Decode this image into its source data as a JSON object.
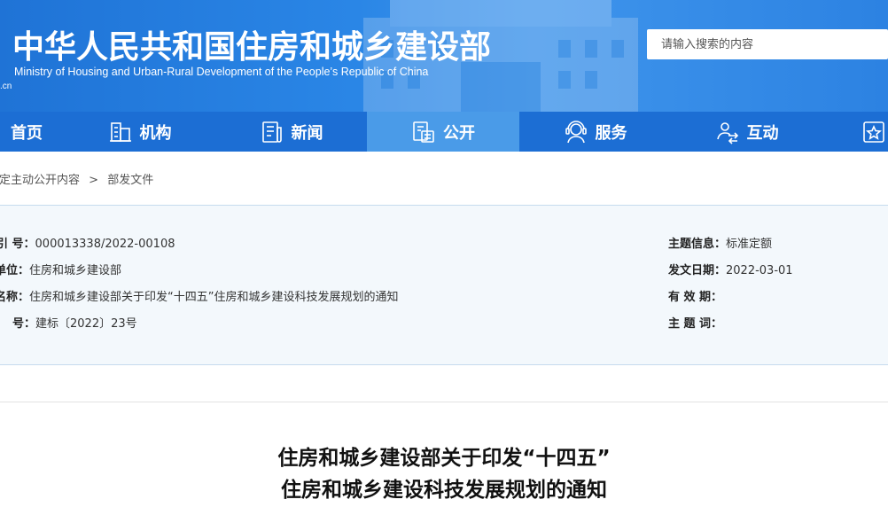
{
  "header": {
    "title": "中华人民共和国住房和城乡建设部",
    "subtitle": "Ministry of Housing and Urban-Rural Development of the People’s Republic of China",
    "domain_fragment": ".cn",
    "search_placeholder": "请输入搜索的内容"
  },
  "nav": {
    "items": [
      {
        "label": "首页",
        "icon": "home-icon"
      },
      {
        "label": "机构",
        "icon": "organization-icon"
      },
      {
        "label": "新闻",
        "icon": "news-icon"
      },
      {
        "label": "公开",
        "icon": "public-info-icon"
      },
      {
        "label": "服务",
        "icon": "service-icon"
      },
      {
        "label": "互动",
        "icon": "interaction-icon"
      },
      {
        "label": "",
        "icon": "star-icon"
      }
    ],
    "active_index": 3
  },
  "breadcrumb": {
    "items": [
      "法定主动公开内容",
      "部发文件"
    ],
    "separator": ">"
  },
  "info": {
    "left": [
      {
        "label": "引  号：",
        "value": "000013338/2022-00108"
      },
      {
        "label": "单位：",
        "value": "住房和城乡建设部"
      },
      {
        "label": "名称：",
        "value": "住房和城乡建设部关于印发“十四五”住房和城乡建设科技发展规划的通知"
      },
      {
        "label": "号：",
        "value": "建标〔2022〕23号"
      }
    ],
    "right": [
      {
        "label": "主题信息：",
        "value": "标准定额"
      },
      {
        "label": "发文日期：",
        "value": "2022-03-01"
      },
      {
        "label": "有 效 期：",
        "value": ""
      },
      {
        "label": "主 题 词：",
        "value": ""
      }
    ]
  },
  "document": {
    "title_line1": "住房和城乡建设部关于印发“十四五”",
    "title_line2": "住房和城乡建设科技发展规划的通知"
  },
  "colors": {
    "header_blue": "#2a86e6",
    "nav_blue": "#1c6ed4",
    "nav_active": "#4a9be8",
    "info_bg": "#f3f8fc"
  }
}
